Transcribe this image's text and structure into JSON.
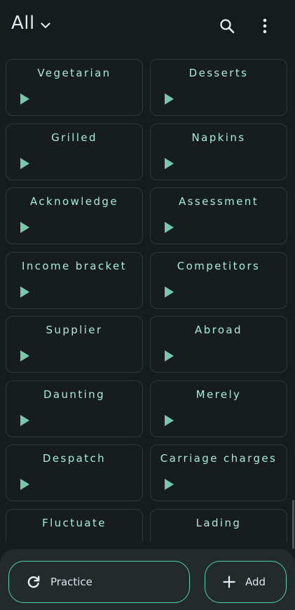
{
  "header": {
    "filter_label": "All",
    "icons": [
      "chevron-down-icon",
      "search-icon",
      "more-vert-icon"
    ]
  },
  "cards": [
    {
      "label": "Vegetarian"
    },
    {
      "label": "Desserts"
    },
    {
      "label": "Grilled"
    },
    {
      "label": "Napkins"
    },
    {
      "label": "Acknowledge"
    },
    {
      "label": "Assessment"
    },
    {
      "label": "Income bracket"
    },
    {
      "label": "Competitors"
    },
    {
      "label": "Supplier"
    },
    {
      "label": "Abroad"
    },
    {
      "label": "Daunting"
    },
    {
      "label": "Merely"
    },
    {
      "label": "Despatch"
    },
    {
      "label": "Carriage charges"
    },
    {
      "label": "Fluctuate"
    },
    {
      "label": "Lading"
    }
  ],
  "bottom": {
    "practice_label": "Practice",
    "add_label": "Add"
  },
  "colors": {
    "background": "#161b1c",
    "card_border": "#2f3839",
    "card_text": "#a9ecd8",
    "play_icon": "#79c7ab",
    "accent": "#4fd3a8",
    "bottom_bar": "#222a2c"
  }
}
